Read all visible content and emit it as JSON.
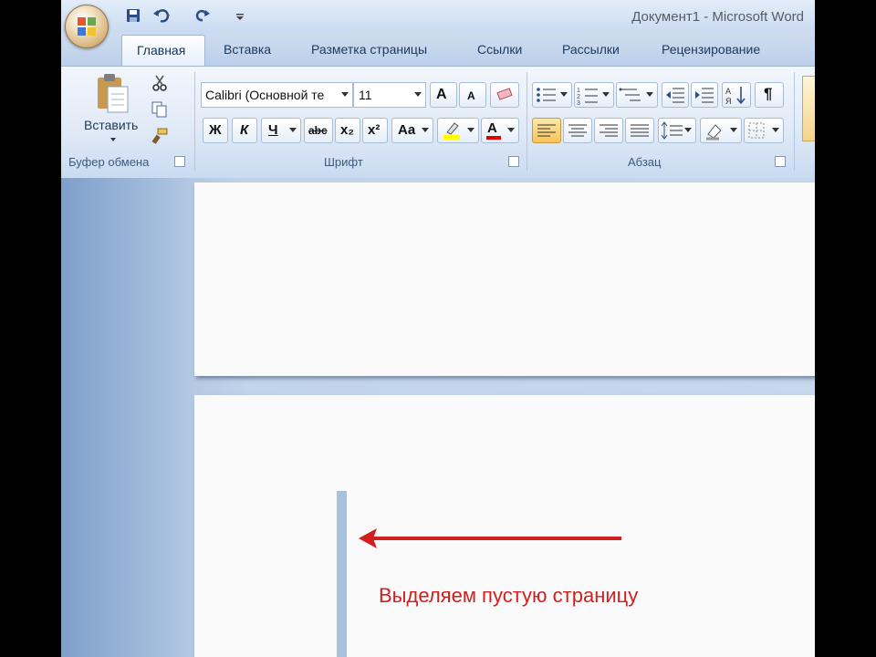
{
  "window": {
    "title": "Документ1 - Microsoft Word"
  },
  "tabs": [
    "Главная",
    "Вставка",
    "Разметка страницы",
    "Ссылки",
    "Рассылки",
    "Рецензирование"
  ],
  "clipboard": {
    "paste_label": "Вставить",
    "group_label": "Буфер обмена"
  },
  "font": {
    "family": "Calibri (Основной те",
    "size": "11",
    "group_label": "Шрифт",
    "bold": "Ж",
    "italic": "К",
    "underline": "Ч",
    "strike": "abc",
    "subscript": "x₂",
    "superscript": "x²",
    "case": "Aa"
  },
  "paragraph": {
    "group_label": "Абзац",
    "pilcrow": "¶"
  },
  "annotation": {
    "text": "Выделяем пустую страницу",
    "color": "#d11f1f"
  },
  "icons": [
    "office-logo-icon",
    "save-icon",
    "undo-icon",
    "redo-icon",
    "paste-icon",
    "cut-icon",
    "copy-icon",
    "format-painter-icon",
    "bullets-icon",
    "numbering-icon",
    "multilevel-icon",
    "align-left-icon",
    "align-center-icon",
    "align-right-icon",
    "justify-icon"
  ]
}
